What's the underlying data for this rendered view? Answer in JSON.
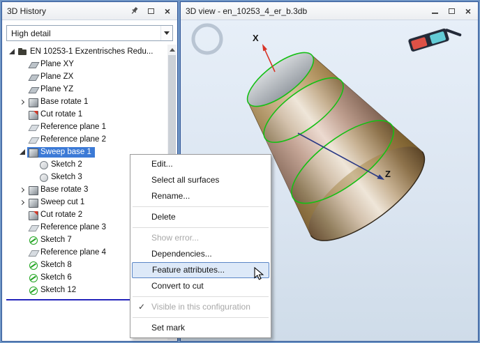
{
  "left_panel": {
    "title": "3D History",
    "titlebar_icons": [
      "pin",
      "maximize",
      "close"
    ],
    "detail_dropdown": {
      "value": "High detail"
    },
    "tree": {
      "items": [
        {
          "label": "EN 10253-1 Exzentrisches Redu...",
          "depth": 0,
          "icon": "folder",
          "expander": "expanded",
          "selected": false
        },
        {
          "label": "Plane XY",
          "depth": 1,
          "icon": "plane",
          "expander": "none",
          "selected": false
        },
        {
          "label": "Plane ZX",
          "depth": 1,
          "icon": "plane",
          "expander": "none",
          "selected": false
        },
        {
          "label": "Plane YZ",
          "depth": 1,
          "icon": "plane",
          "expander": "none",
          "selected": false
        },
        {
          "label": "Base rotate 1",
          "depth": 1,
          "icon": "solid",
          "expander": "collapsed",
          "selected": false
        },
        {
          "label": "Cut rotate 1",
          "depth": 1,
          "icon": "cut",
          "expander": "none",
          "selected": false
        },
        {
          "label": "Reference plane 1",
          "depth": 1,
          "icon": "refplane",
          "expander": "none",
          "selected": false
        },
        {
          "label": "Reference plane 2",
          "depth": 1,
          "icon": "refplane",
          "expander": "none",
          "selected": false
        },
        {
          "label": "Sweep base 1",
          "depth": 1,
          "icon": "solid",
          "expander": "expanded",
          "selected": true
        },
        {
          "label": "Sketch 2",
          "depth": 2,
          "icon": "sketch-gray",
          "expander": "none",
          "selected": false
        },
        {
          "label": "Sketch 3",
          "depth": 2,
          "icon": "sketch-gray",
          "expander": "none",
          "selected": false
        },
        {
          "label": "Base rotate 3",
          "depth": 1,
          "icon": "solid",
          "expander": "collapsed",
          "selected": false
        },
        {
          "label": "Sweep cut 1",
          "depth": 1,
          "icon": "solid",
          "expander": "collapsed",
          "selected": false
        },
        {
          "label": "Cut rotate 2",
          "depth": 1,
          "icon": "cut",
          "expander": "none",
          "selected": false
        },
        {
          "label": "Reference plane 3",
          "depth": 1,
          "icon": "refplane",
          "expander": "none",
          "selected": false
        },
        {
          "label": "Sketch 7",
          "depth": 1,
          "icon": "sketch-green",
          "expander": "none",
          "selected": false
        },
        {
          "label": "Reference plane 4",
          "depth": 1,
          "icon": "refplane",
          "expander": "none",
          "selected": false
        },
        {
          "label": "Sketch 8",
          "depth": 1,
          "icon": "sketch-green",
          "expander": "none",
          "selected": false
        },
        {
          "label": "Sketch 6",
          "depth": 1,
          "icon": "sketch-green",
          "expander": "none",
          "selected": false
        },
        {
          "label": "Sketch 12",
          "depth": 1,
          "icon": "sketch-green",
          "expander": "none",
          "selected": false
        }
      ]
    }
  },
  "right_panel": {
    "title": "3D view - en_10253_4_er_b.3db",
    "titlebar_icons": [
      "minimize",
      "maximize",
      "close"
    ],
    "axes": {
      "x_label": "X",
      "z_label": "Z"
    }
  },
  "context_menu": {
    "check_glyph": "✓",
    "items": [
      {
        "label": "Edit...",
        "state": "normal",
        "separator_after": false
      },
      {
        "label": "Select all surfaces",
        "state": "normal",
        "separator_after": false
      },
      {
        "label": "Rename...",
        "state": "normal",
        "separator_after": true
      },
      {
        "label": "Delete",
        "state": "normal",
        "separator_after": true
      },
      {
        "label": "Show error...",
        "state": "disabled",
        "separator_after": false
      },
      {
        "label": "Dependencies...",
        "state": "normal",
        "separator_after": false
      },
      {
        "label": "Feature attributes...",
        "state": "hover",
        "separator_after": false
      },
      {
        "label": "Convert to cut",
        "state": "normal",
        "separator_after": true
      },
      {
        "label": "Visible in this configuration",
        "state": "disabled",
        "checked": true,
        "separator_after": true
      },
      {
        "label": "Set mark",
        "state": "normal",
        "separator_after": false
      }
    ]
  },
  "colors": {
    "selection_blue": "#3c7ad6",
    "edge_highlight_green": "#15c015",
    "model_bronze": "#c7a87c",
    "axis_x_red": "#d83427",
    "axis_z_blue": "#2b3a85",
    "viewport_bg": "#dbe5f1"
  }
}
